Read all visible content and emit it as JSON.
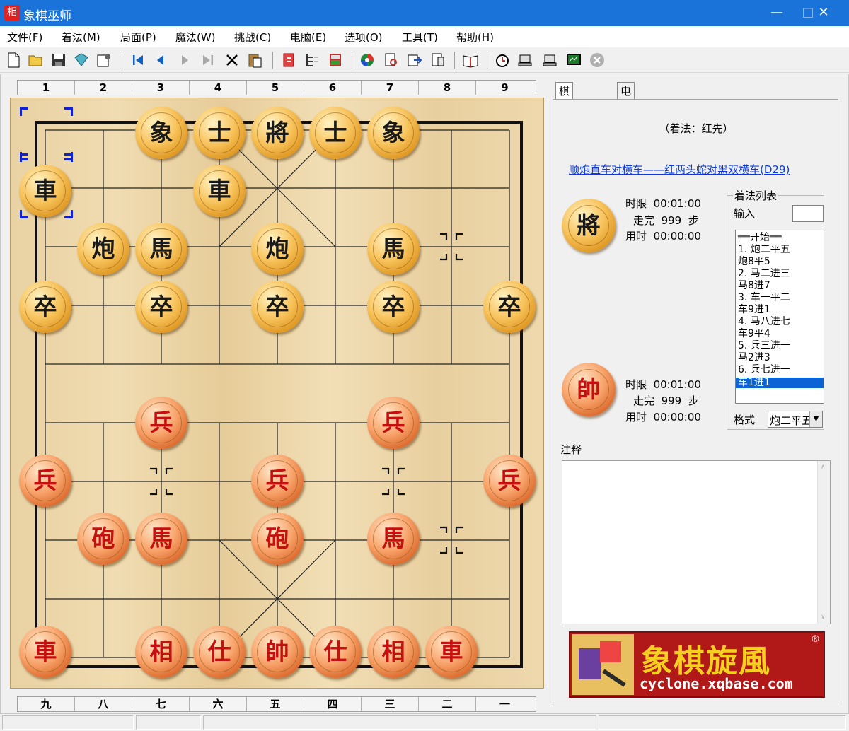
{
  "window": {
    "title": "象棋巫师",
    "app_icon_glyph": "相"
  },
  "menu": [
    "文件(F)",
    "着法(M)",
    "局面(P)",
    "魔法(W)",
    "挑战(C)",
    "电脑(E)",
    "选项(O)",
    "工具(T)",
    "帮助(H)"
  ],
  "board": {
    "top_columns": [
      "1",
      "2",
      "3",
      "4",
      "5",
      "6",
      "7",
      "8",
      "9"
    ],
    "bottom_columns": [
      "九",
      "八",
      "七",
      "六",
      "五",
      "四",
      "三",
      "二",
      "一"
    ],
    "black_pieces": [
      "象",
      "士",
      "將",
      "士",
      "象",
      "車",
      "車",
      "炮",
      "馬",
      "炮",
      "馬",
      "卒",
      "卒",
      "卒",
      "卒",
      "卒"
    ],
    "red_pieces": [
      "兵",
      "兵",
      "兵",
      "兵",
      "兵",
      "砲",
      "馬",
      "砲",
      "馬",
      "車",
      "相",
      "仕",
      "帥",
      "仕",
      "相",
      "車"
    ]
  },
  "tabs": [
    "棋局信息",
    "电脑分析"
  ],
  "info": {
    "move_order": "（着法：红先）",
    "opening_link": "顺炮直车对横车——红两头蛇对黑双横车(D29)",
    "black_player": {
      "piece": "將",
      "time_limit_label": "时限",
      "time_limit": "00:01:00",
      "moves_label": "走完",
      "moves": "999",
      "moves_unit": "步",
      "used_label": "用时",
      "used": "00:00:00"
    },
    "red_player": {
      "piece": "帥",
      "time_limit_label": "时限",
      "time_limit": "00:01:00",
      "moves_label": "走完",
      "moves": "999",
      "moves_unit": "步",
      "used_label": "用时",
      "used": "00:00:00"
    }
  },
  "move_list": {
    "title": "着法列表",
    "input_label": "输入",
    "items": [
      "══开始══",
      "1. 炮二平五",
      "   炮8平5",
      "2. 马二进三",
      "   马8进7",
      "3. 车一平二",
      "   车9进1",
      "4. 马八进七",
      "   车9平4",
      "5. 兵三进一",
      "   马2进3",
      "6. 兵七进一",
      "   车1进1"
    ],
    "selected_index": 12,
    "format_label": "格式",
    "format_value": "炮二平五"
  },
  "notes": {
    "label": "注释",
    "text": ""
  },
  "banner": {
    "title": "象棋旋風",
    "registered": "®",
    "url": "cyclone.xqbase.com"
  },
  "colors": {
    "titlebar": "#1a73d9",
    "link": "#0b3bd8",
    "selection": "#0a64d6",
    "banner_bg": "#b11818",
    "banner_text": "#f5d020"
  }
}
